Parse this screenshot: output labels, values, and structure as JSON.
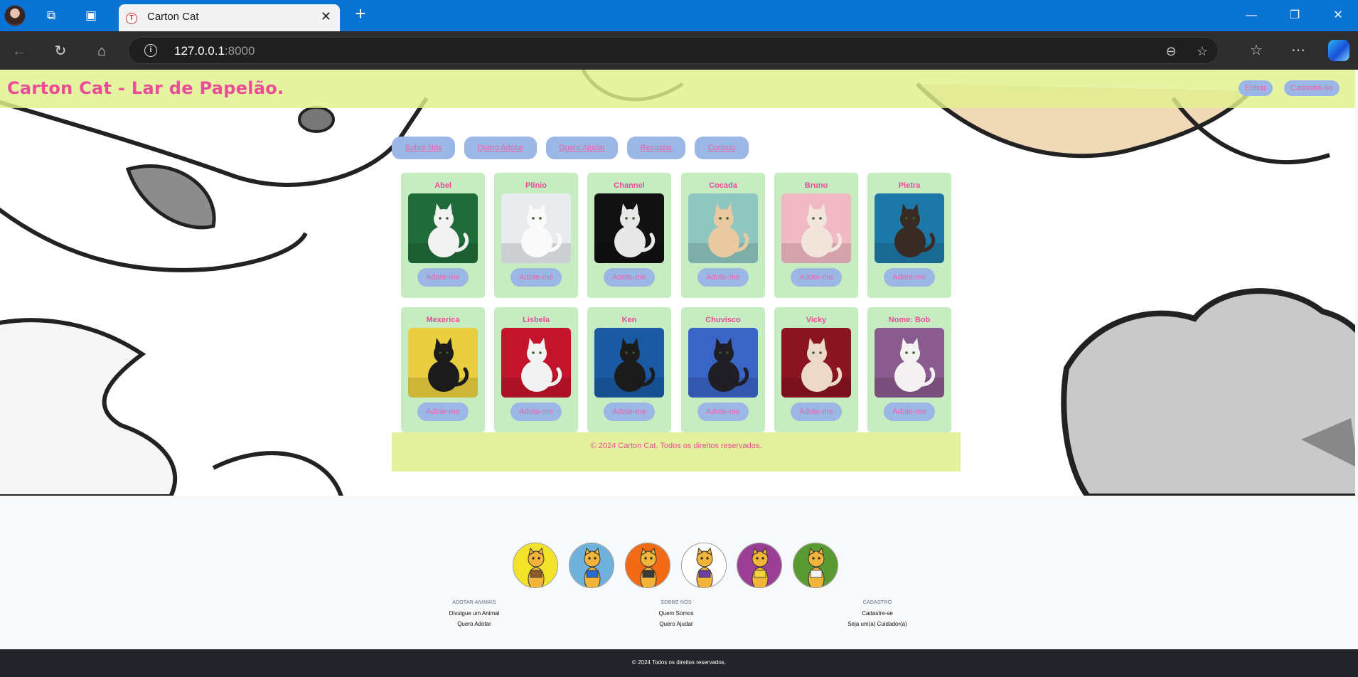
{
  "browser": {
    "tab_title": "Carton Cat",
    "address_host": "127.0.0.1",
    "address_port": ":8000"
  },
  "site": {
    "title": "Carton Cat - Lar de Papelão.",
    "header_buttons": [
      "Entrar",
      "Cadastre-se"
    ],
    "menu": [
      "Sobre Nós",
      "Quero Adotar",
      "Quero Ajudar",
      "Resgatar",
      "Contato"
    ],
    "adopt_label": "Adote-me",
    "cats_row1": [
      {
        "name": "Abel",
        "bg": "#1f6b3a",
        "body": "#f2f2f2"
      },
      {
        "name": "Plínio",
        "bg": "#e9ecef",
        "body": "#fafafa"
      },
      {
        "name": "Channel",
        "bg": "#111111",
        "body": "#e8e8e8"
      },
      {
        "name": "Cocada",
        "bg": "#8fc7c0",
        "body": "#e8c9a0"
      },
      {
        "name": "Bruno",
        "bg": "#f1b9c4",
        "body": "#f2e6dc"
      },
      {
        "name": "Pietra",
        "bg": "#1d78a8",
        "body": "#3a2a24"
      }
    ],
    "cats_row2": [
      {
        "name": "Mexerica",
        "bg": "#e9cf3f",
        "body": "#1b1b1b"
      },
      {
        "name": "Lisbela",
        "bg": "#c4142c",
        "body": "#f2f2f2"
      },
      {
        "name": "Ken",
        "bg": "#1a5aa3",
        "body": "#1b1b1b"
      },
      {
        "name": "Chuvisco",
        "bg": "#3b64c7",
        "body": "#1e1e24"
      },
      {
        "name": "Vicky",
        "bg": "#8b1421",
        "body": "#ecd9c9"
      },
      {
        "name": "Nome: Bob",
        "bg": "#8a5b8e",
        "body": "#f4f1f2"
      }
    ],
    "footer_text": "© 2024 Carton Cat. Todos os direitos reservados.",
    "avatars": [
      "#f2e22a",
      "#6eb2dc",
      "#f26a14",
      "#ffffff",
      "#9b3f94",
      "#5a9a32"
    ],
    "footer_columns": [
      {
        "heading": "ADOTAR ANIMAIS",
        "links": [
          "Divulgue um Animal",
          "Quero Adotar"
        ]
      },
      {
        "heading": "SOBRE NÓS",
        "links": [
          "Quem Somos",
          "Quero Ajudar"
        ]
      },
      {
        "heading": "CADASTRO",
        "links": [
          "Cadastre-se",
          "Seja um(a) Cuidador(a)"
        ]
      }
    ],
    "bottom_text": "© 2024 Todos os direitos reservados."
  }
}
